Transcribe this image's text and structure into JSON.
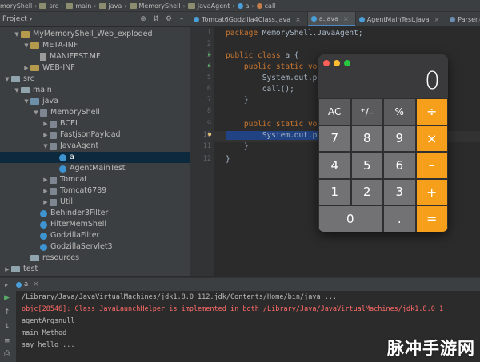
{
  "nav": {
    "crumbs": [
      "moryShell",
      "src",
      "main",
      "java",
      "MemoryShell",
      "JavaAgent",
      "a",
      "call"
    ]
  },
  "project": {
    "title": "Project"
  },
  "tabs": [
    {
      "label": "Tomcat6Godzilla4Class.java",
      "active": false
    },
    {
      "label": "a.java",
      "active": true
    },
    {
      "label": "AgentMainTest.java",
      "active": false
    },
    {
      "label": "Parser.class",
      "active": false
    }
  ],
  "tree": [
    {
      "label": "MyMemoryShell_Web_exploded",
      "indent": 1,
      "arrow": "down",
      "icon": "folder-gold"
    },
    {
      "label": "META-INF",
      "indent": 2,
      "arrow": "down",
      "icon": "folder-gold"
    },
    {
      "label": "MANIFEST.MF",
      "indent": 3,
      "arrow": "",
      "icon": "file"
    },
    {
      "label": "WEB-INF",
      "indent": 2,
      "arrow": "right",
      "icon": "folder-gold"
    },
    {
      "label": "src",
      "indent": 0,
      "arrow": "down",
      "icon": "folder"
    },
    {
      "label": "main",
      "indent": 1,
      "arrow": "down",
      "icon": "folder"
    },
    {
      "label": "java",
      "indent": 2,
      "arrow": "down",
      "icon": "folder-src"
    },
    {
      "label": "MemoryShell",
      "indent": 3,
      "arrow": "down",
      "icon": "package"
    },
    {
      "label": "BCEL",
      "indent": 4,
      "arrow": "right",
      "icon": "package"
    },
    {
      "label": "FastjsonPayload",
      "indent": 4,
      "arrow": "right",
      "icon": "package"
    },
    {
      "label": "JavaAgent",
      "indent": 4,
      "arrow": "down",
      "icon": "package"
    },
    {
      "label": "a",
      "indent": 5,
      "arrow": "",
      "icon": "class",
      "selected": true
    },
    {
      "label": "AgentMainTest",
      "indent": 5,
      "arrow": "",
      "icon": "class"
    },
    {
      "label": "Tomcat",
      "indent": 4,
      "arrow": "right",
      "icon": "package"
    },
    {
      "label": "Tomcat6789",
      "indent": 4,
      "arrow": "right",
      "icon": "package"
    },
    {
      "label": "Util",
      "indent": 4,
      "arrow": "right",
      "icon": "package"
    },
    {
      "label": "Behinder3Filter",
      "indent": 3,
      "arrow": "",
      "icon": "class"
    },
    {
      "label": "FilterMemShell",
      "indent": 3,
      "arrow": "",
      "icon": "class"
    },
    {
      "label": "GodzillaFilter",
      "indent": 3,
      "arrow": "",
      "icon": "class"
    },
    {
      "label": "GodzillaServlet3",
      "indent": 3,
      "arrow": "",
      "icon": "class"
    },
    {
      "label": "resources",
      "indent": 2,
      "arrow": "",
      "icon": "folder"
    },
    {
      "label": "test",
      "indent": 0,
      "arrow": "right",
      "icon": "folder"
    }
  ],
  "editor": {
    "line_numbers": [
      "1",
      "2",
      "3",
      "4",
      "5",
      "6",
      "7",
      "8",
      "9",
      "10",
      "11",
      "12"
    ],
    "lines": [
      {
        "kw": "package",
        "rest": " MemoryShell.JavaAgent;"
      },
      {
        "kw": "",
        "rest": ""
      },
      {
        "kw": "public class",
        "rest": " a {"
      },
      {
        "kw": "    public static voi",
        "rest": ""
      },
      {
        "kw": "",
        "rest": "        System.out.pr"
      },
      {
        "kw": "",
        "rest": "        call();"
      },
      {
        "kw": "",
        "rest": "    }"
      },
      {
        "kw": "",
        "rest": ""
      },
      {
        "kw": "    public static voi",
        "rest": ""
      },
      {
        "kw": "",
        "rest": "        System.out.pr"
      },
      {
        "kw": "",
        "rest": "    }"
      },
      {
        "kw": "",
        "rest": "}"
      }
    ]
  },
  "calculator": {
    "display": "0",
    "keys": [
      "AC",
      "⁺∕₋",
      "%",
      "÷",
      "7",
      "8",
      "9",
      "×",
      "4",
      "5",
      "6",
      "–",
      "1",
      "2",
      "3",
      "+",
      "0",
      ".",
      "="
    ]
  },
  "run": {
    "tab_label": "a"
  },
  "console": [
    {
      "text": "/Library/Java/JavaVirtualMachines/jdk1.8.0_112.jdk/Contents/Home/bin/java ...",
      "err": false
    },
    {
      "text": "objc[28546]: Class JavaLaunchHelper is implemented in both /Library/Java/JavaVirtualMachines/jdk1.8.0_1",
      "err": true
    },
    {
      "text": "agentArgsnull",
      "err": false
    },
    {
      "text": "main Method",
      "err": false
    },
    {
      "text": "say hello ...",
      "err": false
    }
  ],
  "watermark": "脉冲手游网",
  "colors": {
    "accent": "#4a88c7",
    "calc_operator": "#f59f1b",
    "error": "#ff6b68",
    "keyword": "#cc7832"
  }
}
